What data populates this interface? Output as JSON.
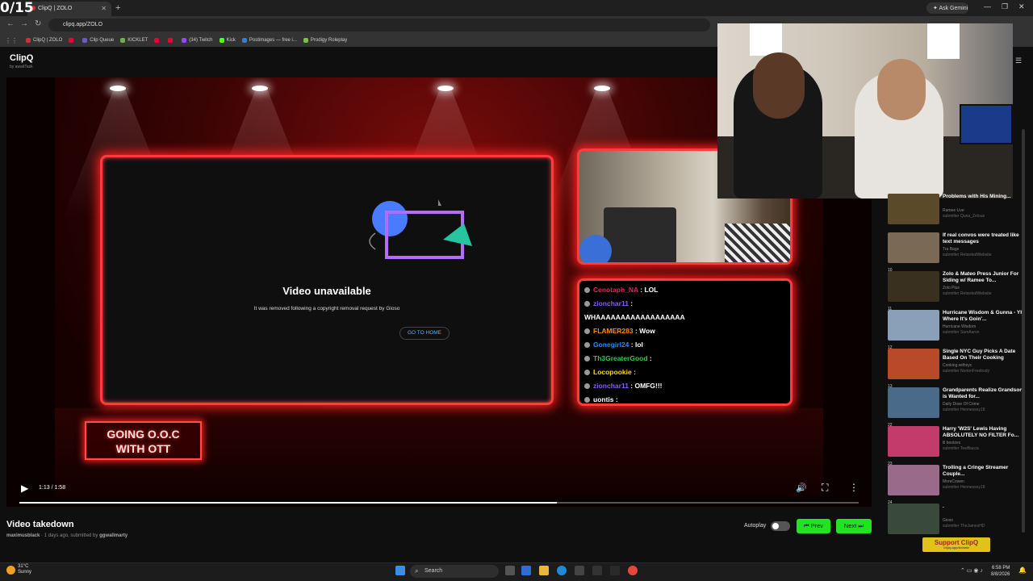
{
  "overlay_counter": "0/15",
  "browser": {
    "tab_title": "ClipQ | ZOLO",
    "new_tab": "+",
    "ask_gemini": "Ask Gemini",
    "url": "clipq.app/ZOLO",
    "bookmarks": [
      {
        "label": "ClipQ | ZOLO",
        "color": "#c33"
      },
      {
        "label": "",
        "color": "#e03"
      },
      {
        "label": "Clip Queue",
        "color": "#6a5acd"
      },
      {
        "label": "KICKLET",
        "color": "#6ab04c"
      },
      {
        "label": "",
        "color": "#e03"
      },
      {
        "label": "",
        "color": "#e03"
      },
      {
        "label": "(34) Twitch",
        "color": "#9146ff"
      },
      {
        "label": "Kick",
        "color": "#53fc18"
      },
      {
        "label": "Postimages — free i...",
        "color": "#3a7bd5"
      },
      {
        "label": "Prodigy Roleplay",
        "color": "#7bc043"
      }
    ]
  },
  "app": {
    "name": "ClipQ",
    "byline": "by awaitTask"
  },
  "player": {
    "time": "1:13 / 1:58",
    "progress_fraction": 0.64,
    "unavailable_title": "Video unavailable",
    "unavailable_msg": "It was removed following a copyright removal request by Gioso",
    "go_home": "GO TO HOME",
    "logo_line1": "GOING O.O.C",
    "logo_line2": "WITH OTT"
  },
  "chat": [
    {
      "user": "Cenotaph_NA",
      "msg": " : LOL",
      "color": "#e0245e"
    },
    {
      "user": "zionchar11",
      "msg": " :",
      "color": "#8a5cf6"
    },
    {
      "user": "",
      "msg": "WHAAAAAAAAAAAAAAAAAA",
      "color": "#fff"
    },
    {
      "user": "FLAMER283",
      "msg": " : Wow",
      "color": "#ff8c00"
    },
    {
      "user": "Gonegirl24",
      "msg": " : lol",
      "color": "#1e90ff"
    },
    {
      "user": "Th3GreaterGood",
      "msg": " :",
      "color": "#2ecc40"
    },
    {
      "user": "Locopookie",
      "msg": " :",
      "color": "#ffd700"
    },
    {
      "user": "zionchar11",
      "msg": " : OMFG!!!",
      "color": "#8a5cf6"
    },
    {
      "user": "uontis",
      "msg": " :",
      "color": "#fff"
    }
  ],
  "video": {
    "title": "Video takedown",
    "channel": "maximusblack",
    "meta": " · 1 days ago, submitted by ",
    "submitter": "ggwallmarty"
  },
  "controls": {
    "autoplay": "Autoplay",
    "prev": "⏮ Prev",
    "next": "Next ⏭"
  },
  "queue": [
    {
      "num": "",
      "title": "Problems with His Mining...",
      "channel": "Ramee Live",
      "sub": "submitter Quna_Zelous",
      "color": "#5a4a2a"
    },
    {
      "num": "",
      "title": "If real convos were treated like text messages",
      "channel": "Tra Bags",
      "sub": "submitter RetardedWebsite",
      "color": "#7a6a55"
    },
    {
      "num": "10",
      "title": "Zolo & Mateo Press Junior For Siding w/ Ramee To...",
      "channel": "Zolo Plus",
      "sub": "submitter RetardedWebsite",
      "color": "#3a3020"
    },
    {
      "num": "11",
      "title": "Hurricane Wisdom & Gunna - YK Where It's Goin'...",
      "channel": "Hurricane Wisdom",
      "sub": "submitter SamAaron",
      "color": "#8aa0b8"
    },
    {
      "num": "12",
      "title": "Single NYC Guy Picks A Date Based On Their Cooking",
      "channel": "Cooking.withnyc",
      "sub": "submitter NortonFreebody",
      "color": "#b84a2a"
    },
    {
      "num": "13",
      "title": "Grandparents Realize Grandson is Wanted for...",
      "channel": "Daily Dose Of Crime",
      "sub": "submitter Hennessey18",
      "color": "#4a6a8a"
    },
    {
      "num": "22",
      "title": "Harry 'W2S' Lewis Having ABSOLUTELY NO FILTER Fo...",
      "channel": "lil bootzes",
      "sub": "submitter TewBacca",
      "color": "#c23b6a"
    },
    {
      "num": "23",
      "title": "Trolling a Cringe Streamer Couple...",
      "channel": "MoreCowen",
      "sub": "submitter Hennessey18",
      "color": "#9a6a8a"
    },
    {
      "num": "24",
      "title": ".",
      "channel": "Gioso",
      "sub": "submitter TheJamesHD",
      "color": "#3a4a3a"
    }
  ],
  "support": {
    "label": "Support ClipQ",
    "sub": "clipq.app/donate"
  },
  "taskbar": {
    "temp": "31°C",
    "weather": "Sunny",
    "search": "Search",
    "time": "6:58 PM",
    "date": "8/8/2026"
  },
  "accent": "#ff3b3b",
  "button_green": "#22e322"
}
